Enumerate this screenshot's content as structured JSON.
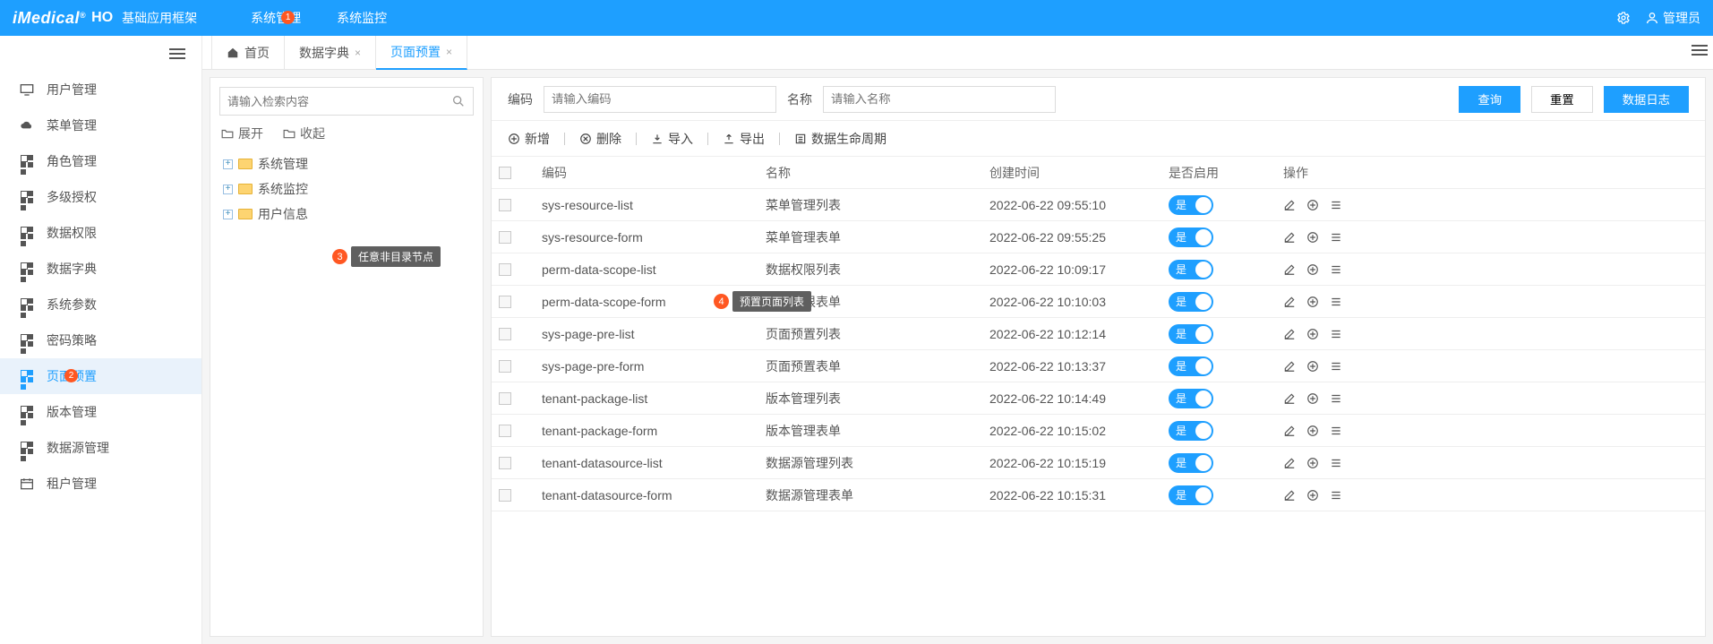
{
  "top": {
    "brand_main": "iMedical",
    "brand_reg": "®",
    "brand_sub": "HO",
    "app_title": "基础应用框架",
    "menu": [
      {
        "label": "系统管理",
        "badge": "1"
      },
      {
        "label": "系统监控"
      }
    ],
    "user_label": "管理员"
  },
  "sidebar": {
    "items": [
      {
        "icon": "monitor",
        "label": "用户管理"
      },
      {
        "icon": "cloud",
        "label": "菜单管理"
      },
      {
        "icon": "grid",
        "label": "角色管理"
      },
      {
        "icon": "grid",
        "label": "多级授权"
      },
      {
        "icon": "grid",
        "label": "数据权限"
      },
      {
        "icon": "grid",
        "label": "数据字典"
      },
      {
        "icon": "grid",
        "label": "系统参数"
      },
      {
        "icon": "grid",
        "label": "密码策略"
      },
      {
        "icon": "grid",
        "label": "页面预置",
        "active": true,
        "badge": "2"
      },
      {
        "icon": "grid",
        "label": "版本管理"
      },
      {
        "icon": "grid",
        "label": "数据源管理"
      },
      {
        "icon": "calendar",
        "label": "租户管理"
      }
    ]
  },
  "tabs": [
    {
      "label": "首页",
      "home": true
    },
    {
      "label": "数据字典",
      "closable": true
    },
    {
      "label": "页面预置",
      "closable": true,
      "active": true
    }
  ],
  "tree": {
    "search_placeholder": "请输入检索内容",
    "expand": "展开",
    "collapse": "收起",
    "nodes": [
      "系统管理",
      "系统监控",
      "用户信息"
    ]
  },
  "annotations": {
    "a3": {
      "num": "3",
      "text": "任意非目录节点"
    },
    "a4": {
      "num": "4",
      "text": "预置页面列表"
    }
  },
  "filter": {
    "code_label": "编码",
    "code_placeholder": "请输入编码",
    "name_label": "名称",
    "name_placeholder": "请输入名称",
    "query": "查询",
    "reset": "重置",
    "log": "数据日志"
  },
  "toolbar": {
    "add": "新增",
    "del": "删除",
    "import": "导入",
    "export": "导出",
    "lifecycle": "数据生命周期"
  },
  "table": {
    "headers": {
      "code": "编码",
      "name": "名称",
      "created": "创建时间",
      "enabled": "是否启用",
      "ops": "操作"
    },
    "switch_on": "是",
    "rows": [
      {
        "code": "sys-resource-list",
        "name": "菜单管理列表",
        "created": "2022-06-22 09:55:10"
      },
      {
        "code": "sys-resource-form",
        "name": "菜单管理表单",
        "created": "2022-06-22 09:55:25"
      },
      {
        "code": "perm-data-scope-list",
        "name": "数据权限列表",
        "created": "2022-06-22 10:09:17"
      },
      {
        "code": "perm-data-scope-form",
        "name": "数据权限表单",
        "created": "2022-06-22 10:10:03"
      },
      {
        "code": "sys-page-pre-list",
        "name": "页面预置列表",
        "created": "2022-06-22 10:12:14"
      },
      {
        "code": "sys-page-pre-form",
        "name": "页面预置表单",
        "created": "2022-06-22 10:13:37"
      },
      {
        "code": "tenant-package-list",
        "name": "版本管理列表",
        "created": "2022-06-22 10:14:49"
      },
      {
        "code": "tenant-package-form",
        "name": "版本管理表单",
        "created": "2022-06-22 10:15:02"
      },
      {
        "code": "tenant-datasource-list",
        "name": "数据源管理列表",
        "created": "2022-06-22 10:15:19"
      },
      {
        "code": "tenant-datasource-form",
        "name": "数据源管理表单",
        "created": "2022-06-22 10:15:31"
      }
    ]
  }
}
